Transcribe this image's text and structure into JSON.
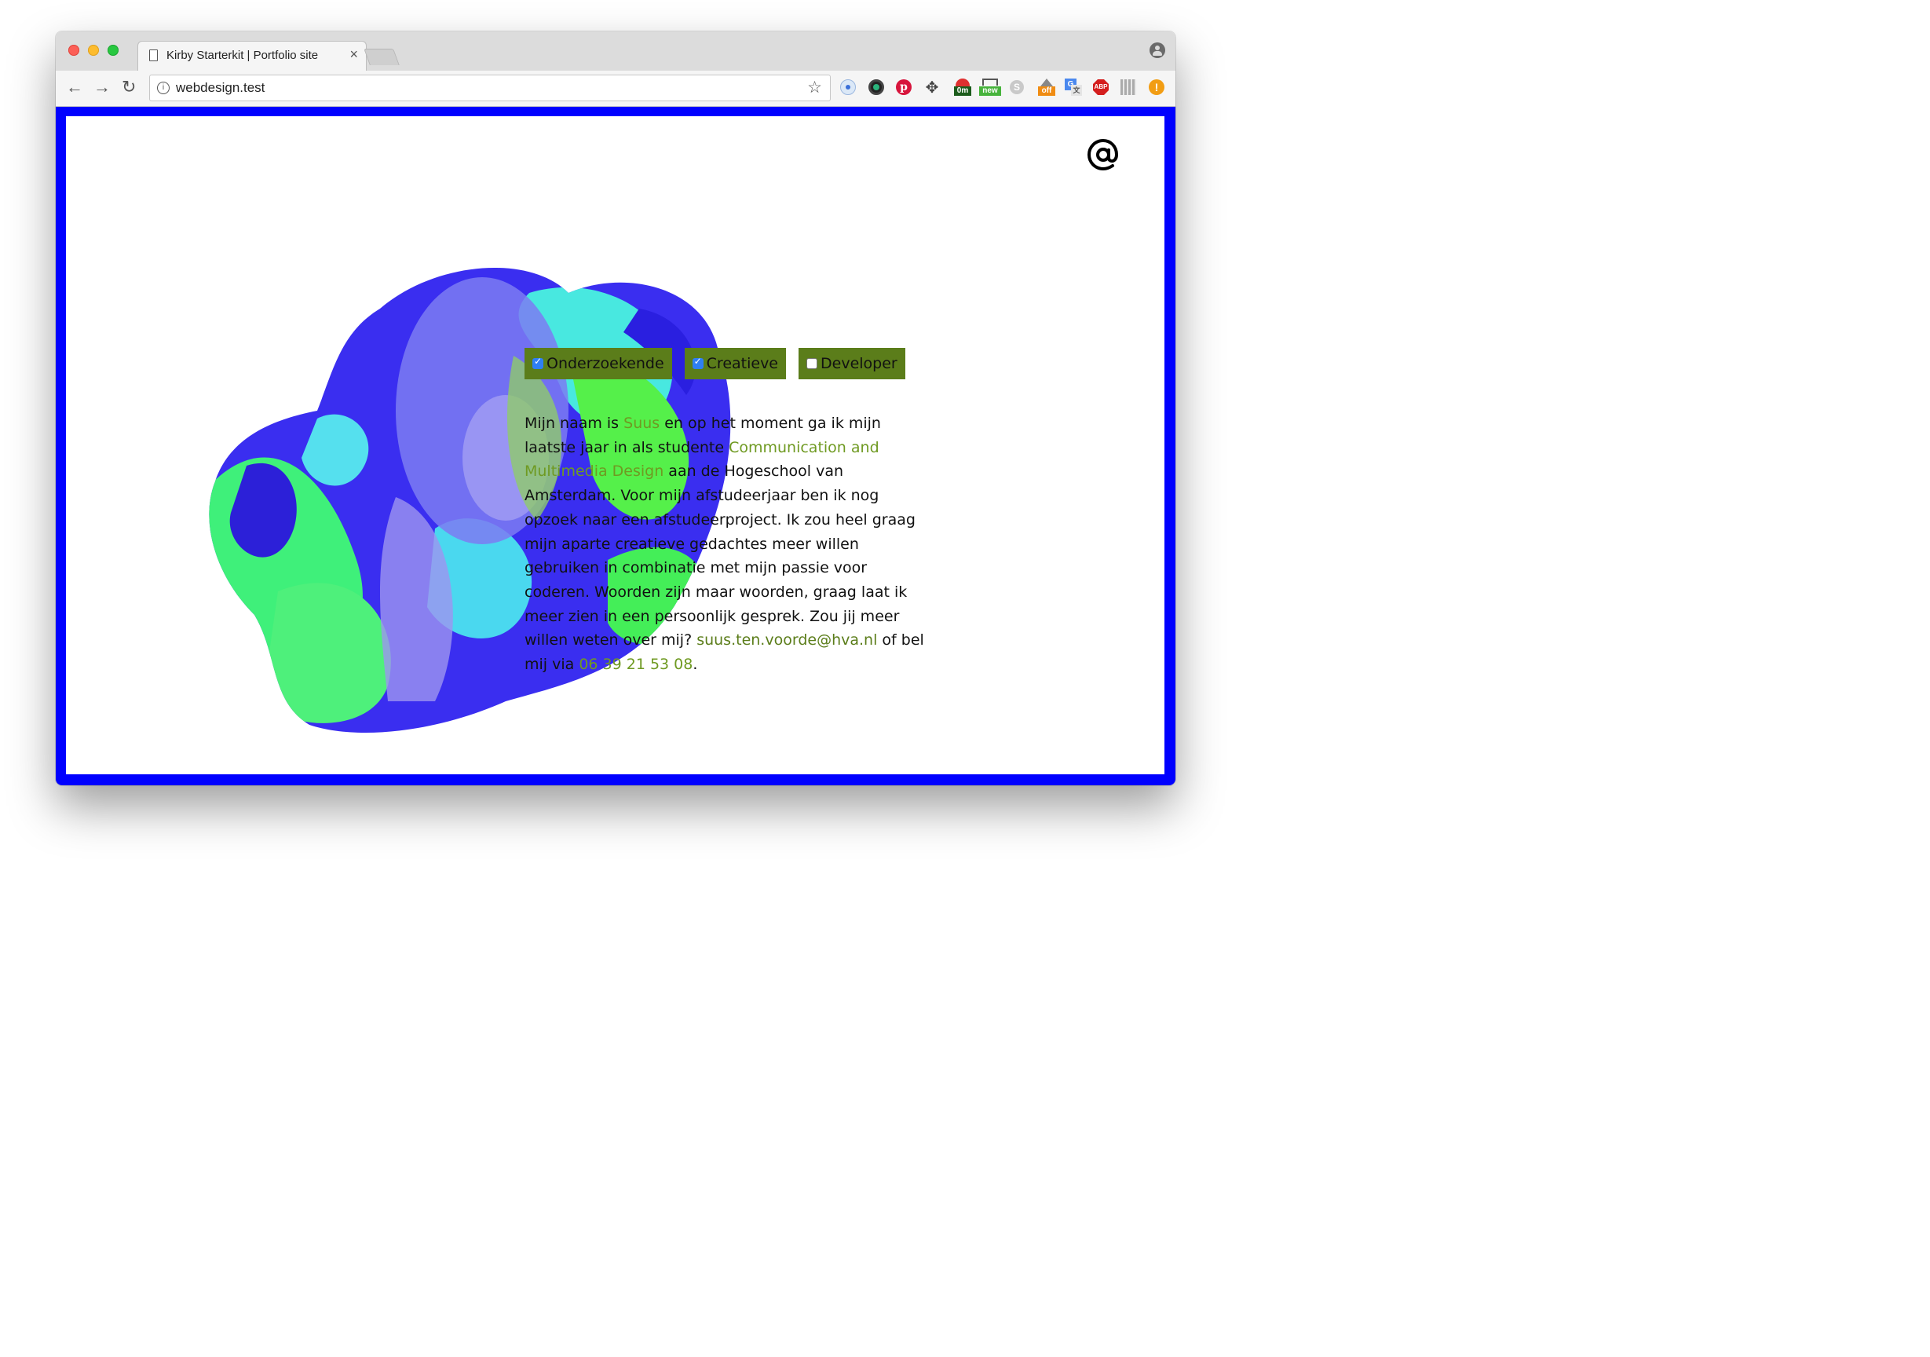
{
  "browser": {
    "tab_title": "Kirby Starterkit | Portfolio site",
    "tab_close": "×",
    "url": "webdesign.test",
    "extensions": [
      "record-icon",
      "camera-lens-icon",
      "pinterest-icon",
      "move-icon",
      "timer-0m-icon",
      "new-badge-icon",
      "skype-icon",
      "off-badge-icon",
      "google-translate-icon",
      "adblock-plus-icon",
      "qr-code-icon",
      "warning-icon"
    ],
    "ext_labels": {
      "timer": "0m",
      "new": "new",
      "off": "off",
      "abp": "ABP",
      "warn": "!"
    }
  },
  "page": {
    "border_color": "#0000ff",
    "accent_color": "#5b7d1a",
    "contact_icon": "at-sign-icon",
    "checkboxes": [
      {
        "label": "Onderzoekende",
        "checked": true
      },
      {
        "label": "Creatieve",
        "checked": true
      },
      {
        "label": "Developer",
        "checked": false
      }
    ],
    "bio": {
      "t1": "Mijn naam is ",
      "name": "Suus",
      "t2": " en op het moment ga ik mijn laatste jaar in als studente ",
      "study": "Communication and Multimedia Design",
      "t3": " aan de Hogeschool van Amsterdam. Voor mijn afstudeerjaar ben ik nog opzoek naar een afstudeerproject. Ik zou heel graag mijn aparte creatieve gedachtes meer willen gebruiken in combinatie met mijn passie voor coderen. Woorden zijn maar woorden, graag laat ik meer zien in een persoonlijk gesprek. Zou jij meer willen weten over mij? ",
      "email": "suus.ten.voorde@hva.nl",
      "t4": " of bel mij via ",
      "phone": "06 39 21 53 08",
      "t5": "."
    }
  }
}
